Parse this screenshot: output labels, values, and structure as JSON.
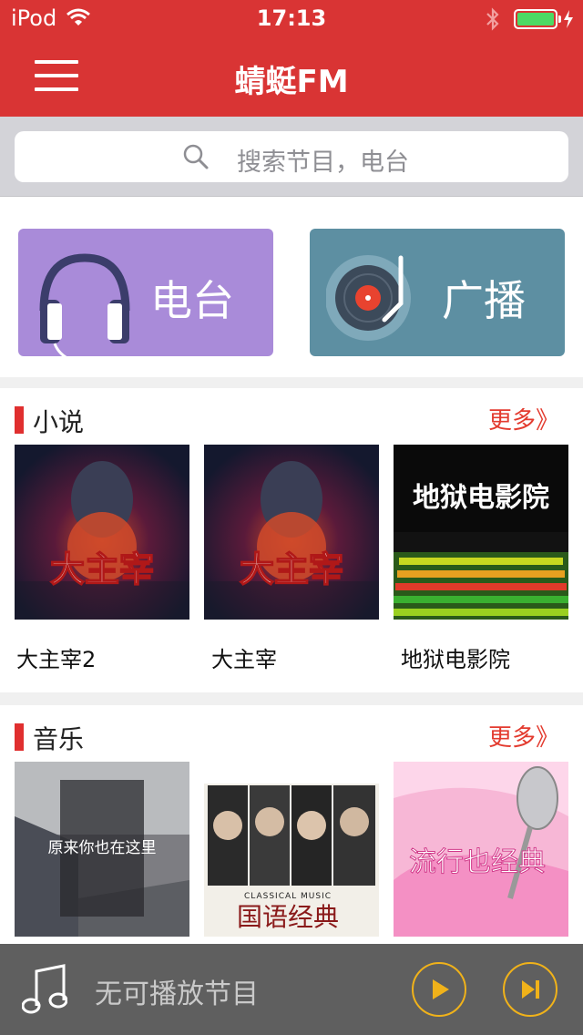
{
  "status_bar": {
    "carrier": "iPod",
    "time": "17:13"
  },
  "nav": {
    "title": "蜻蜓FM"
  },
  "search": {
    "placeholder": "搜索节目，电台"
  },
  "categories": [
    {
      "label": "电台",
      "icon": "headphones-icon",
      "color": "#a98bd9"
    },
    {
      "label": "广播",
      "icon": "vinyl-record-icon",
      "color": "#5d8fa2"
    }
  ],
  "sections": {
    "novel": {
      "title": "小说",
      "more": "更多》",
      "items": [
        {
          "title": "大主宰2",
          "cover_text": "大主宰"
        },
        {
          "title": "大主宰",
          "cover_text": "大主宰"
        },
        {
          "title": "地狱电影院",
          "cover_text": "地狱电影院"
        }
      ]
    },
    "music": {
      "title": "音乐",
      "more": "更多》",
      "items": [
        {
          "cover_text": "原来你也在这里"
        },
        {
          "cover_text": "国语经典",
          "cover_subtext": "CLASSICAL MUSIC"
        },
        {
          "cover_text": "流行也经典"
        }
      ]
    }
  },
  "player": {
    "status": "无可播放节目"
  },
  "colors": {
    "brand_red": "#d93434",
    "accent_orange": "#f0b21a"
  }
}
